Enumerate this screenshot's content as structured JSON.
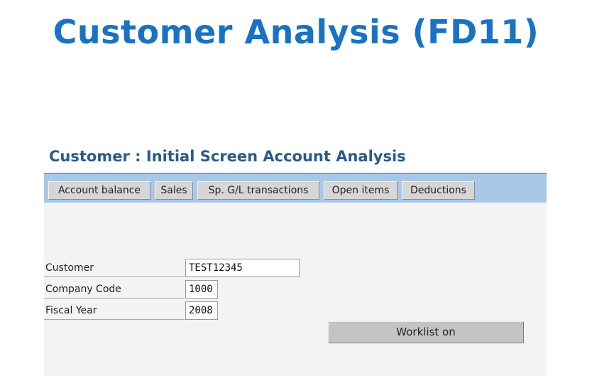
{
  "slide": {
    "title": "Customer Analysis (FD11)"
  },
  "screen": {
    "title": "Customer : Initial Screen Account Analysis"
  },
  "toolbar": {
    "buttons": [
      {
        "label": "Account balance"
      },
      {
        "label": "Sales"
      },
      {
        "label": "Sp. G/L transactions"
      },
      {
        "label": "Open items"
      },
      {
        "label": "Deductions"
      }
    ]
  },
  "form": {
    "customer": {
      "label": "Customer",
      "value": "TEST12345"
    },
    "company_code": {
      "label": "Company Code",
      "value": "1000"
    },
    "fiscal_year": {
      "label": "Fiscal Year",
      "value": "2008"
    }
  },
  "actions": {
    "worklist_label": "Worklist on"
  },
  "colors": {
    "title_blue": "#1a73c2",
    "screen_title": "#2c5a8a",
    "toolbar_bg": "#a9c8e8",
    "workarea_bg": "#f3f3f3"
  }
}
